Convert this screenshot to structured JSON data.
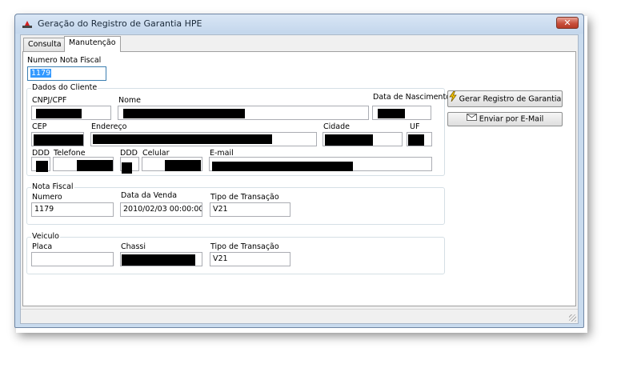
{
  "window": {
    "title": "Geração do Registro de Garantia HPE",
    "close_label": "✕"
  },
  "tabs": [
    {
      "label": "Consulta"
    },
    {
      "label": "Manutenção"
    }
  ],
  "numero_nf": {
    "label": "Numero Nota Fiscal",
    "value": "1179"
  },
  "dados_cliente": {
    "title": "Dados do Cliente",
    "cnpj_label": "CNPJ/CPF",
    "nome_label": "Nome",
    "nasc_label": "Data de Nascimento",
    "cep_label": "CEP",
    "endereco_label": "Endereço",
    "cidade_label": "Cidade",
    "uf_label": "UF",
    "ddd_label": "DDD",
    "telefone_label": "Telefone",
    "ddd2_label": "DDD",
    "celular_label": "Celular",
    "email_label": "E-mail"
  },
  "nota_fiscal": {
    "title": "Nota Fiscal",
    "numero_label": "Numero",
    "numero_value": "1179",
    "data_label": "Data da Venda",
    "data_value": "2010/02/03 00:00:00",
    "tipo_label": "Tipo de Transação",
    "tipo_value": "V21"
  },
  "veiculo": {
    "title": "Veiculo",
    "placa_label": "Placa",
    "placa_value": "",
    "chassi_label": "Chassi",
    "tipo_label": "Tipo de Transação",
    "tipo_value": "V21"
  },
  "buttons": {
    "gerar": "Gerar Registro de Garantia",
    "email": "Enviar por E-Mail"
  },
  "icons": {
    "app": "app-logo-icon",
    "gerar": "lightning-icon",
    "email": "envelope-icon",
    "close": "close-icon"
  },
  "colors": {
    "title_bar": "#c9dbee",
    "selection": "#3399ff",
    "close_button": "#c9503c"
  }
}
